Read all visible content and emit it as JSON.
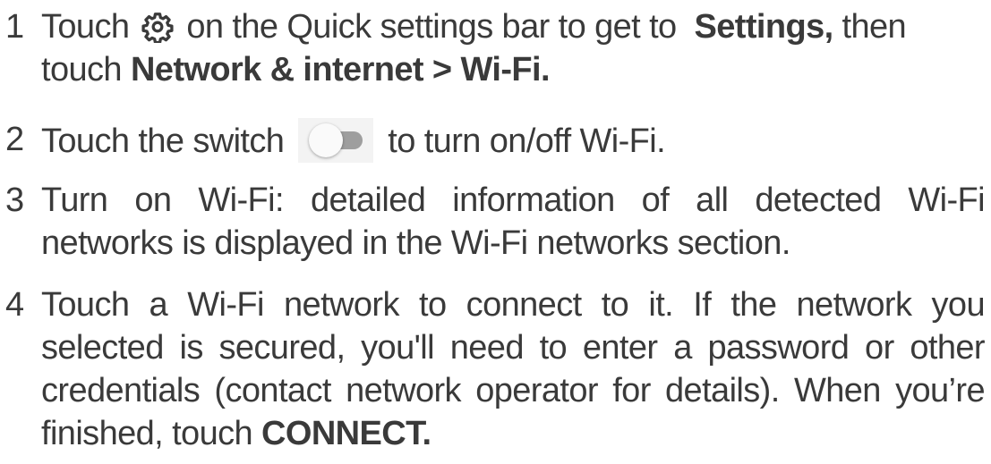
{
  "steps": [
    {
      "number": "1",
      "lines": [
        {
          "t1": "Touch",
          "icon": "gear-icon",
          "t2": "on the Quick settings bar to get to",
          "bold1": "Settings,",
          "t3": "then"
        },
        {
          "t1": "touch",
          "bold1": "Network & internet > Wi-Fi."
        }
      ]
    },
    {
      "number": "2",
      "lines": [
        {
          "t1": "Touch the switch",
          "icon": "toggle-switch-icon",
          "t2": "to turn on/off Wi-Fi."
        }
      ]
    },
    {
      "number": "3",
      "lines": [
        "Turn on Wi-Fi: detailed information of all detected Wi-Fi",
        "networks is displayed in the Wi-Fi networks section."
      ]
    },
    {
      "number": "4",
      "lines": [
        "Touch a Wi-Fi network to connect to it. If the network you",
        "selected is secured, you'll need to enter a password or other",
        "credentials (contact network operator for details). When you’re"
      ],
      "last_line": {
        "t1": "finished, touch",
        "bold1": "CONNECT."
      }
    }
  ],
  "colors": {
    "text": "#3a3a3a",
    "switch_track": "#9e9e9e",
    "switch_knob": "#fafafa",
    "switch_bg": "#f3f3f3"
  }
}
